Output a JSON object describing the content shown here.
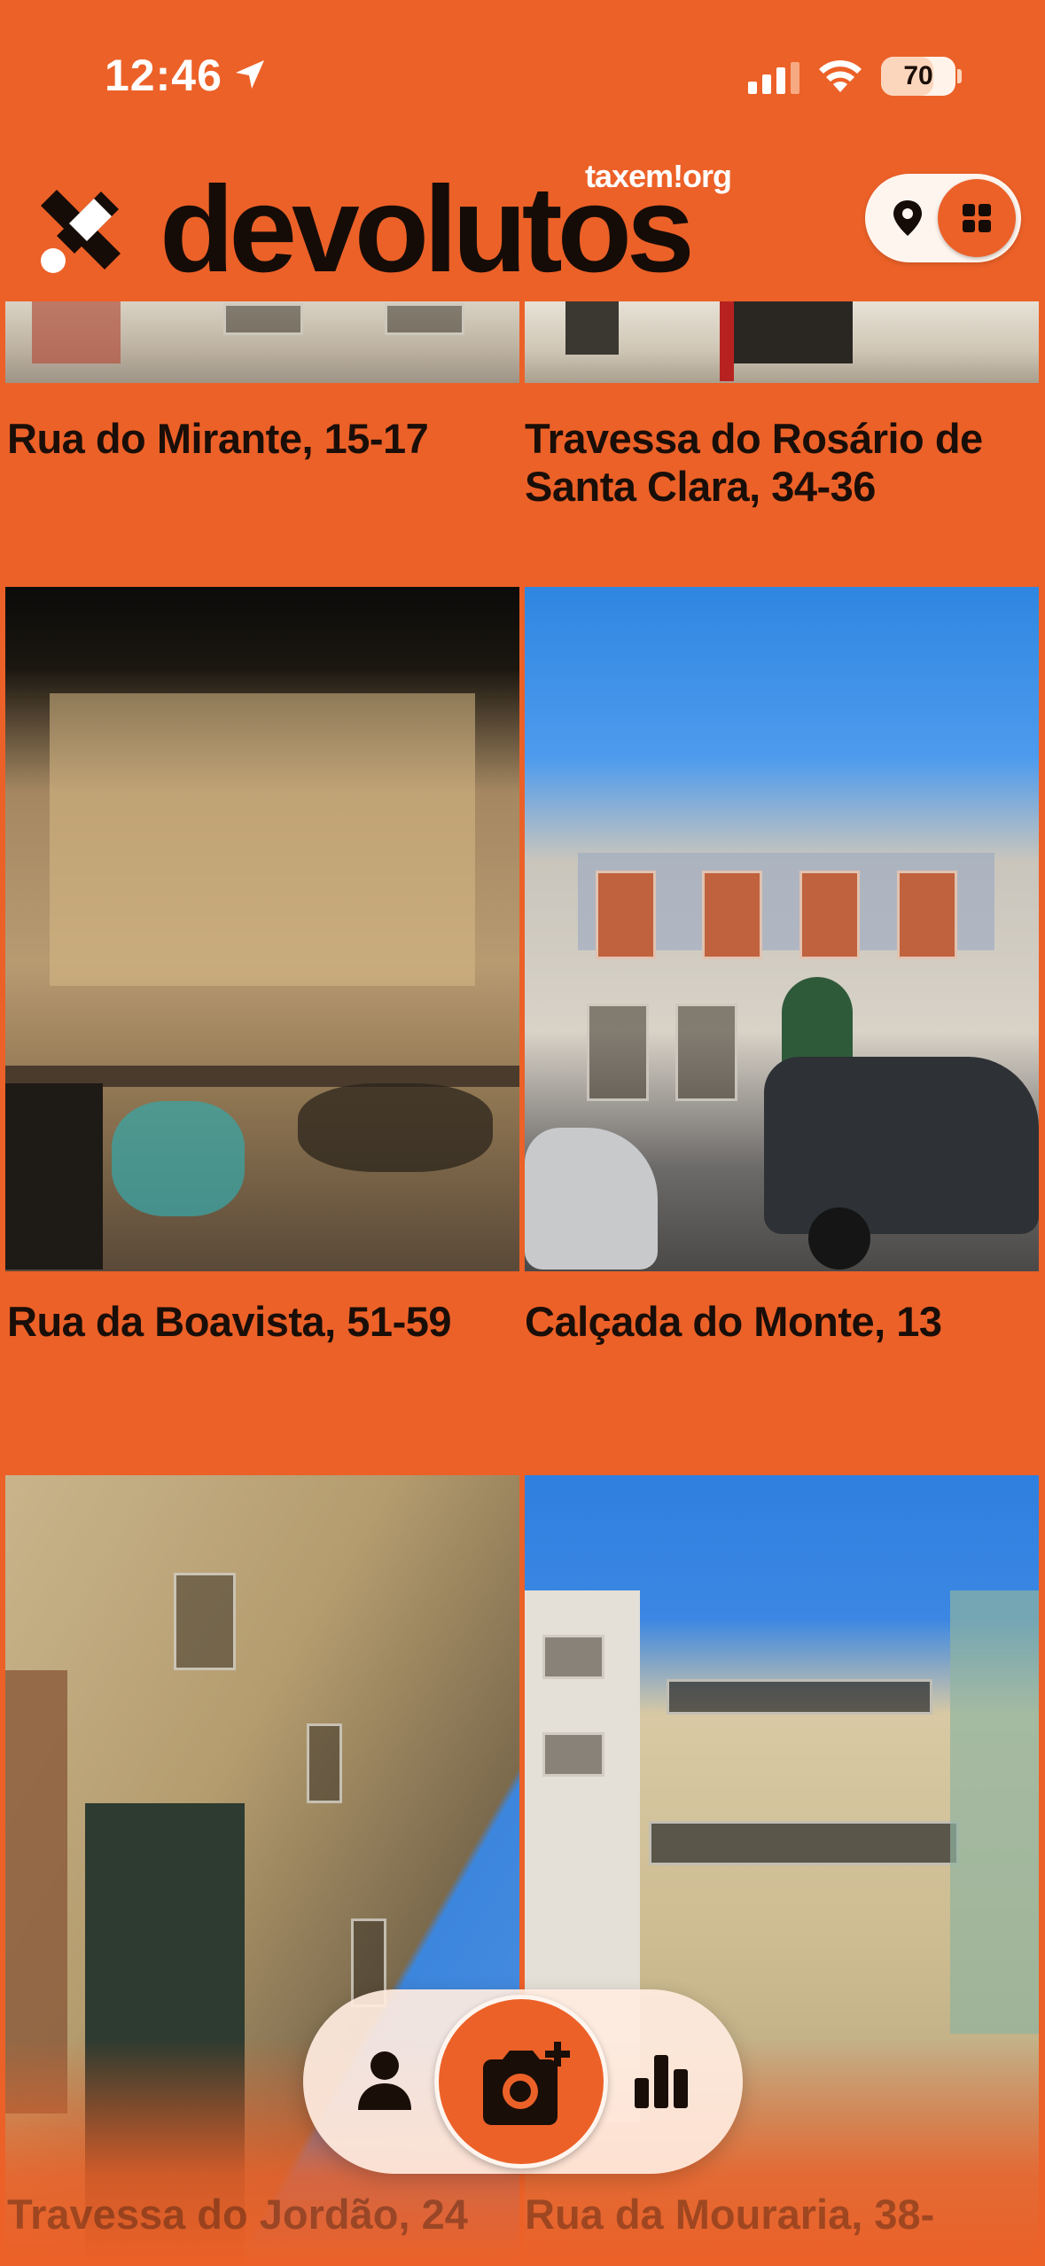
{
  "status_bar": {
    "time": "12:46",
    "battery": "70",
    "battery_level": 0.7
  },
  "header": {
    "app_title": "devolutos",
    "brand_tag": "taxem!org",
    "view_toggle": {
      "left_icon": "map-pin-icon",
      "right_icon": "grid-icon",
      "selected": "grid"
    }
  },
  "listings": [
    {
      "address": "Rua do Mirante, 15-17"
    },
    {
      "address": "Travessa do Rosário de Santa Clara, 34-36"
    },
    {
      "address": "Rua da Boavista, 51-59"
    },
    {
      "address": "Calçada do Monte, 13"
    },
    {
      "address": "Travessa do Jordão, 24"
    },
    {
      "address": "Rua da Mouraria, 38-"
    }
  ],
  "tab_bar": {
    "items": [
      {
        "icon": "profile-icon"
      },
      {
        "icon": "camera-add-icon",
        "active": true
      },
      {
        "icon": "stats-icon"
      }
    ]
  },
  "colors": {
    "accent": "#ec6128",
    "text": "#1a0e08",
    "surface": "#fff5ef"
  }
}
